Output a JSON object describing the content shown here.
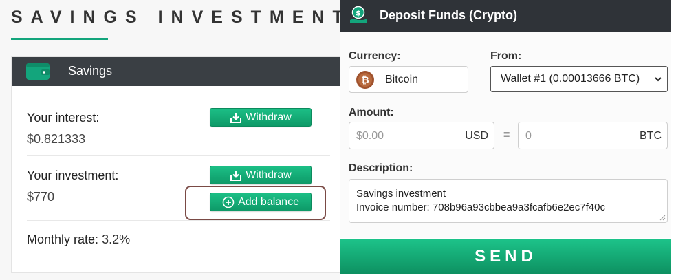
{
  "page": {
    "heading": "SAVINGS INVESTMENT"
  },
  "savings_card": {
    "title": "Savings",
    "interest_label": "Your interest:",
    "interest_value": "$0.821333",
    "investment_label": "Your investment:",
    "investment_value": "$770",
    "withdraw_label": "Withdraw",
    "add_balance_label": "Add balance",
    "monthly_rate_label": "Monthly rate:",
    "monthly_rate_value": "3.2%"
  },
  "deposit_modal": {
    "title": "Deposit Funds (Crypto)",
    "currency_label": "Currency:",
    "currency_value": "Bitcoin",
    "from_label": "From:",
    "from_value": "Wallet #1 (0.00013666 BTC)",
    "amount_label": "Amount:",
    "amount_usd_placeholder": "$0.00",
    "amount_usd_unit": "USD",
    "equals": "=",
    "amount_btc_placeholder": "0",
    "amount_btc_unit": "BTC",
    "description_label": "Description:",
    "description_lines": [
      "Savings investment",
      "Invoice number: 708b96a93cbbea9a3fcafb6e2ec7f40c"
    ],
    "send_label": "SEND"
  },
  "colors": {
    "accent_green": "#13a57c",
    "header_dark": "#2f3338",
    "highlight_outline": "#7a4a45",
    "bitcoin": "#a0522d"
  }
}
